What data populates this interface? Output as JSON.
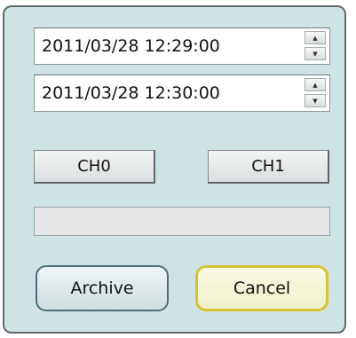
{
  "dialog": {
    "start_datetime": "2011/03/28 12:29:00",
    "end_datetime": "2011/03/28 12:30:00",
    "spin_up_glyph": "▲",
    "spin_down_glyph": "▼",
    "channel_buttons": [
      "CH0",
      "CH1"
    ],
    "progress_fraction": 0,
    "archive_label": "Archive",
    "cancel_label": "Cancel"
  },
  "colors": {
    "window_background": "#cfe3e4",
    "cancel_focus_border": "#d7c433"
  }
}
